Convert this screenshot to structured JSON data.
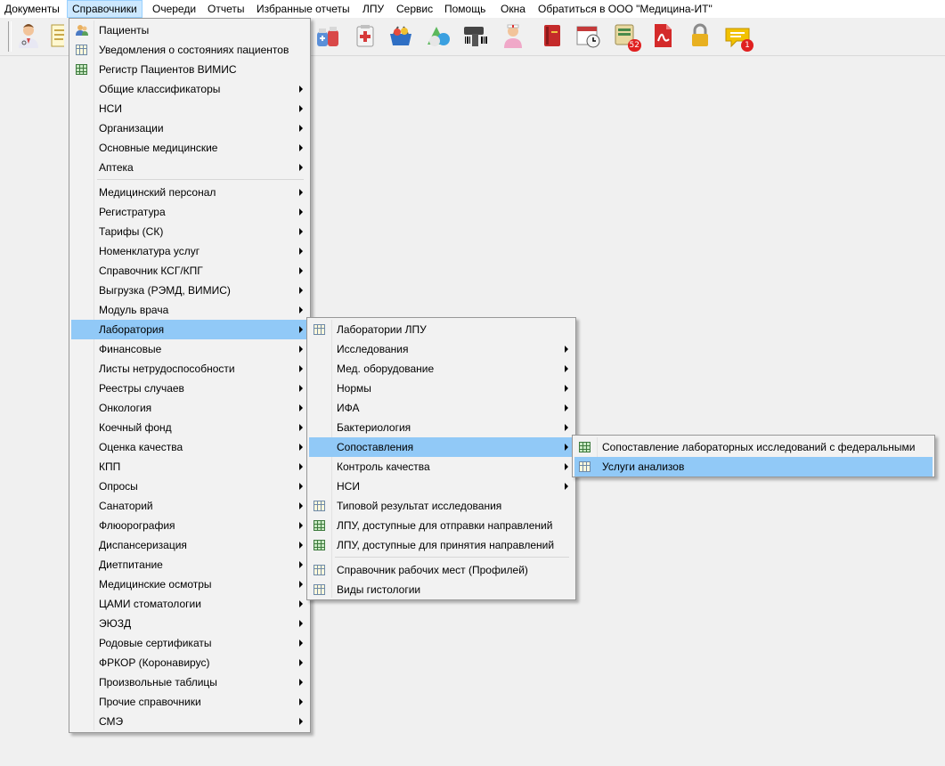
{
  "menubar": [
    {
      "label": "Документы"
    },
    {
      "label": "Справочники",
      "open": true
    },
    {
      "label": "Очереди"
    },
    {
      "label": "Отчеты"
    },
    {
      "label": "Избранные отчеты"
    },
    {
      "label": "ЛПУ"
    },
    {
      "label": "Сервис"
    },
    {
      "label": "Помощь"
    },
    {
      "label": "Окна"
    },
    {
      "label": "Обратиться в ООО \"Медицина-ИТ\""
    }
  ],
  "toolbar": {
    "buttons": [
      {
        "icon": "doctor-icon"
      },
      {
        "icon": "documents-icon"
      },
      {
        "icon": "medicine-bottles-icon"
      },
      {
        "icon": "first-aid-kit-icon"
      },
      {
        "icon": "basket-icon"
      },
      {
        "icon": "pills-icon"
      },
      {
        "icon": "barcode-scanner-icon"
      },
      {
        "icon": "nurse-icon"
      },
      {
        "icon": "red-book-icon"
      },
      {
        "icon": "calendar-clock-icon"
      },
      {
        "icon": "queue-icon",
        "badge": "52"
      },
      {
        "icon": "pdf-document-icon"
      },
      {
        "icon": "lock-icon"
      },
      {
        "icon": "chat-icon",
        "badge": "1"
      }
    ]
  },
  "menu_main": {
    "items": [
      {
        "label": "Пациенты",
        "icon": "patients-icon"
      },
      {
        "label": "Уведомления о состояниях пациентов",
        "icon": "grid-icon"
      },
      {
        "label": "Регистр Пациентов ВИМИС",
        "icon": "grid-green-icon"
      },
      {
        "label": "Общие классификаторы",
        "submenu": true
      },
      {
        "label": "НСИ",
        "submenu": true
      },
      {
        "label": "Организации",
        "submenu": true
      },
      {
        "label": "Основные медицинские",
        "submenu": true
      },
      {
        "label": "Аптека",
        "submenu": true,
        "separator_after": true
      },
      {
        "label": "Медицинский персонал",
        "submenu": true
      },
      {
        "label": "Регистратура",
        "submenu": true
      },
      {
        "label": "Тарифы (СК)",
        "submenu": true
      },
      {
        "label": "Номенклатура услуг",
        "submenu": true
      },
      {
        "label": "Справочник КСГ/КПГ",
        "submenu": true
      },
      {
        "label": "Выгрузка (РЭМД, ВИМИС)",
        "submenu": true
      },
      {
        "label": "Модуль врача",
        "submenu": true
      },
      {
        "label": "Лаборатория",
        "submenu": true,
        "highlighted": true
      },
      {
        "label": "Финансовые",
        "submenu": true
      },
      {
        "label": "Листы нетрудоспособности",
        "submenu": true
      },
      {
        "label": "Реестры случаев",
        "submenu": true
      },
      {
        "label": "Онкология",
        "submenu": true
      },
      {
        "label": "Коечный фонд",
        "submenu": true
      },
      {
        "label": "Оценка качества",
        "submenu": true
      },
      {
        "label": "КПП",
        "submenu": true
      },
      {
        "label": "Опросы",
        "submenu": true
      },
      {
        "label": "Санаторий",
        "submenu": true
      },
      {
        "label": "Флюорография",
        "submenu": true
      },
      {
        "label": "Диспансеризация",
        "submenu": true
      },
      {
        "label": "Диетпитание",
        "submenu": true
      },
      {
        "label": "Медицинские осмотры",
        "submenu": true
      },
      {
        "label": "ЦАМИ стоматологии",
        "submenu": true
      },
      {
        "label": "ЭЮЗД",
        "submenu": true
      },
      {
        "label": "Родовые сертификаты",
        "submenu": true
      },
      {
        "label": "ФРКОР (Коронавирус)",
        "submenu": true
      },
      {
        "label": "Произвольные таблицы",
        "submenu": true
      },
      {
        "label": "Прочие справочники",
        "submenu": true
      },
      {
        "label": "СМЭ",
        "submenu": true
      }
    ]
  },
  "menu_lab": {
    "items": [
      {
        "label": "Лаборатории ЛПУ",
        "icon": "grid-icon"
      },
      {
        "label": "Исследования",
        "submenu": true
      },
      {
        "label": "Мед. оборудование",
        "submenu": true
      },
      {
        "label": "Нормы",
        "submenu": true
      },
      {
        "label": "ИФА",
        "submenu": true
      },
      {
        "label": "Бактериология",
        "submenu": true
      },
      {
        "label": "Сопоставления",
        "submenu": true,
        "highlighted": true
      },
      {
        "label": "Контроль качества",
        "submenu": true
      },
      {
        "label": "НСИ",
        "submenu": true
      },
      {
        "label": "Типовой результат исследования",
        "icon": "grid-icon"
      },
      {
        "label": "ЛПУ, доступные для отправки направлений",
        "icon": "grid-green-icon"
      },
      {
        "label": "ЛПУ, доступные для принятия направлений",
        "icon": "grid-green-icon",
        "separator_after": true
      },
      {
        "label": "Справочник рабочих мест (Профилей)",
        "icon": "grid-icon"
      },
      {
        "label": "Виды гистологии",
        "icon": "grid-icon"
      }
    ]
  },
  "menu_mapping": {
    "items": [
      {
        "label": "Сопоставление лабораторных исследований с федеральными",
        "icon": "grid-green-icon"
      },
      {
        "label": "Услуги анализов",
        "icon": "grid-icon",
        "highlighted": true
      }
    ]
  },
  "colors": {
    "menu_highlight": "#91c9f7",
    "menubar_open": "#cce8ff",
    "badge": "#e02020"
  }
}
